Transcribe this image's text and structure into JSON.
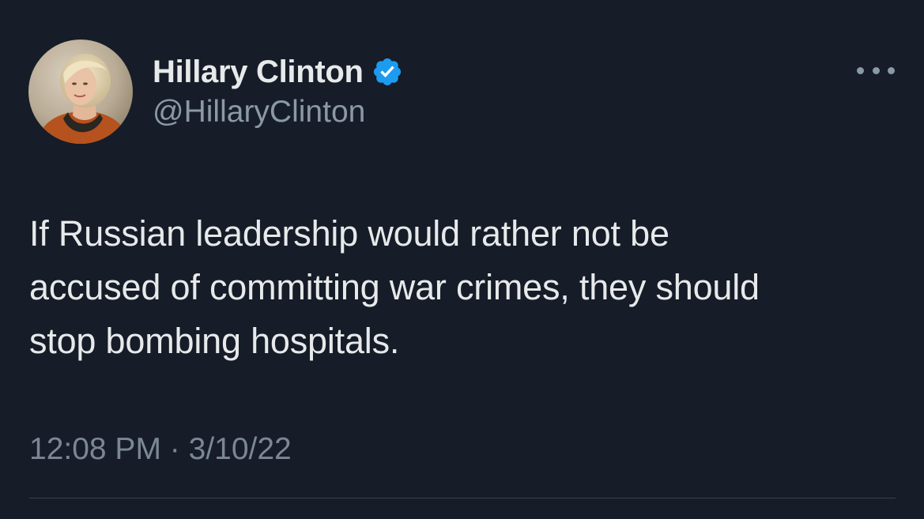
{
  "tweet": {
    "author": {
      "display_name": "Hillary Clinton",
      "handle": "@HillaryClinton",
      "verified": true,
      "avatar_icon": "profile-photo"
    },
    "text_lines": [
      "If Russian leadership would rather not be",
      "accused of committing war crimes, they should",
      "stop bombing hospitals."
    ],
    "time": "12:08 PM",
    "separator": "·",
    "date": "3/10/22",
    "more_icon": "more-horizontal-icon"
  },
  "colors": {
    "background": "#161d28",
    "text": "#e7e9ea",
    "secondary_text": "#8b98a5",
    "verified_blue": "#1d9bf0",
    "divider": "#38444d"
  }
}
